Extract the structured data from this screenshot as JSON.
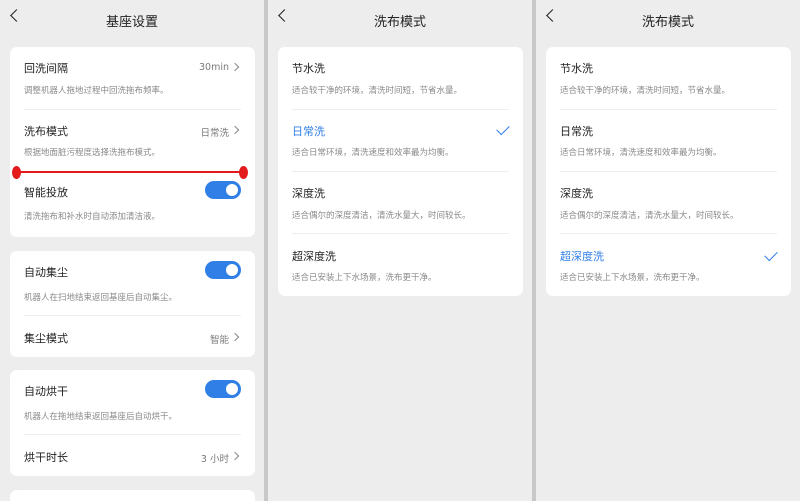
{
  "panel1": {
    "title": "基座设置",
    "card1": {
      "rows": [
        {
          "label": "回洗间隔",
          "desc": "调整机器人拖地过程中回洗拖布频率。",
          "value": "30min"
        },
        {
          "label": "洗布模式",
          "desc": "根据地面脏污程度选择洗拖布模式。",
          "value": "日常洗"
        },
        {
          "label": "智能投放",
          "desc": "清洗拖布和补水时自动添加清洁液。",
          "toggle": true
        }
      ]
    },
    "card2": {
      "rows": [
        {
          "label": "自动集尘",
          "desc": "机器人在扫地结束返回基座后自动集尘。",
          "toggle": true
        },
        {
          "label": "集尘模式",
          "value": "智能"
        }
      ]
    },
    "card3": {
      "rows": [
        {
          "label": "自动烘干",
          "desc": "机器人在拖地结束返回基座后自动烘干。",
          "toggle": true
        },
        {
          "label": "烘干时长",
          "value": "3 小时"
        }
      ]
    },
    "annotation_color": "#e31b1b"
  },
  "panel2": {
    "title": "洗布模式",
    "selected": "日常洗",
    "options": [
      {
        "label": "节水洗",
        "desc": "适合较干净的环境，清洗时间短，节省水量。"
      },
      {
        "label": "日常洗",
        "desc": "适合日常环境，清洗速度和效率最为均衡。"
      },
      {
        "label": "深度洗",
        "desc": "适合偶尔的深度清洁，清洗水量大，时间较长。"
      },
      {
        "label": "超深度洗",
        "desc": "适合已安装上下水场景，洗布更干净。"
      }
    ]
  },
  "panel3": {
    "title": "洗布模式",
    "selected": "超深度洗",
    "options": [
      {
        "label": "节水洗",
        "desc": "适合较干净的环境，清洗时间短，节省水量。"
      },
      {
        "label": "日常洗",
        "desc": "适合日常环境，清洗速度和效率最为均衡。"
      },
      {
        "label": "深度洗",
        "desc": "适合偶尔的深度清洁，清洗水量大，时间较长。"
      },
      {
        "label": "超深度洗",
        "desc": "适合已安装上下水场景，洗布更干净。"
      }
    ]
  },
  "colors": {
    "accent": "#2f7fe6",
    "background": "#ededed",
    "card": "#ffffff"
  },
  "icons": {
    "back": "chevron-left-icon",
    "row": "chevron-right-icon",
    "selected": "checkmark-icon"
  }
}
